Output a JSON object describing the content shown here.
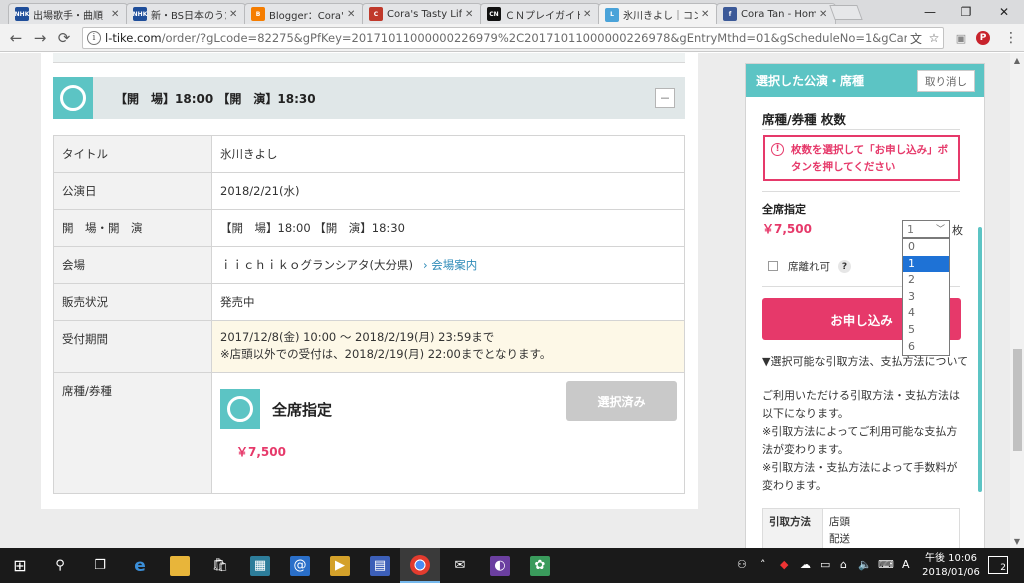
{
  "browser": {
    "tabs": [
      {
        "label": "出場歌手・曲順",
        "favicon": "nhk-icon",
        "fav_color": "#1f4e9a",
        "fav_text": "NHK"
      },
      {
        "label": "新・BS日本のうた",
        "favicon": "nhk-icon",
        "fav_color": "#1f4e9a",
        "fav_text": "NHK"
      },
      {
        "label": "Blogger：Cora's",
        "favicon": "blogger-icon",
        "fav_color": "#f57d00",
        "fav_text": "B"
      },
      {
        "label": "Cora's Tasty Life",
        "favicon": "blog-icon",
        "fav_color": "#c0392b",
        "fav_text": "C"
      },
      {
        "label": "ＣＮプレイガイド",
        "favicon": "cn-icon",
        "fav_color": "#111111",
        "fav_text": "CN"
      },
      {
        "label": "氷川きよし｜コンサ",
        "favicon": "ltike-icon",
        "fav_color": "#4aa3d9",
        "fav_text": "L"
      },
      {
        "label": "Cora Tan - Home",
        "favicon": "facebook-icon",
        "fav_color": "#3b5998",
        "fav_text": "f"
      }
    ],
    "active_tab": 5,
    "url_host": "l-tike.com",
    "url_path": "/order/?gLcode=82275&gPfKey=20171011000000226979%2C20171011000000226978&gEntryMthd=01&gScheduleNo=1&gCarrierCd=08&gPfName..."
  },
  "performance": {
    "header": "【開　場】18:00 【開　演】18:30",
    "collapse_symbol": "－",
    "rows": [
      {
        "label": "タイトル",
        "value": "氷川きよし"
      },
      {
        "label": "公演日",
        "value": "2018/2/21(水)"
      },
      {
        "label": "開　場・開　演",
        "value": "【開　場】18:00 【開　演】18:30"
      },
      {
        "label": "会場",
        "value": "ｉｉｃｈｉｋｏグランシアタ(大分県)",
        "link": "会場案内"
      },
      {
        "label": "販売状況",
        "value": "発売中"
      }
    ],
    "reception": {
      "label": "受付期間",
      "line1": "2017/12/8(金) 10:00 ～ 2018/2/19(月) 23:59まで",
      "line2": "※店頭以外での受付は、2018/2/19(月) 22:00までとなります。"
    },
    "seat": {
      "label": "席種/券種",
      "name": "全席指定",
      "button": "選択済み",
      "price": "￥7,500"
    }
  },
  "selection_panel": {
    "title": "選択した公演・席種",
    "cancel": "取り消し",
    "section_title": "席種/券種 枚数",
    "alert_line1": "枚数を選択して「お申し込み」ボ",
    "alert_line2": "タンを押してください",
    "seat_label": "全席指定",
    "seat_price": "￥7,500",
    "qty_value": "1",
    "qty_unit": "枚",
    "qty_options": [
      "0",
      "1",
      "2",
      "3",
      "4",
      "5",
      "6"
    ],
    "qty_selected_index": 1,
    "separate_seats": "席離れ可",
    "help": "?",
    "apply": "お申し込み",
    "pay_heading": "▼選択可能な引取方法、支払方法について",
    "pay_lines": [
      "ご利用いただける引取方法・支払方法は以下になります。",
      "※引取方法によってご利用可能な支払方法が変わります。",
      "※引取方法・支払方法によって手数料が変わります。"
    ],
    "method_label": "引取方法",
    "method_values": [
      "店頭",
      "配送"
    ]
  },
  "taskbar": {
    "time": "午後 10:06",
    "date": "2018/01/06",
    "notifications": "2",
    "ime": "A",
    "apps": [
      "start-icon",
      "search-icon",
      "task-view-icon",
      "edge-icon",
      "file-explorer-icon",
      "store-icon",
      "calculator-icon",
      "mail-icon",
      "media-icon",
      "calendar-icon",
      "chrome-icon",
      "mail-envelope-icon",
      "app-icon",
      "photos-icon"
    ]
  }
}
